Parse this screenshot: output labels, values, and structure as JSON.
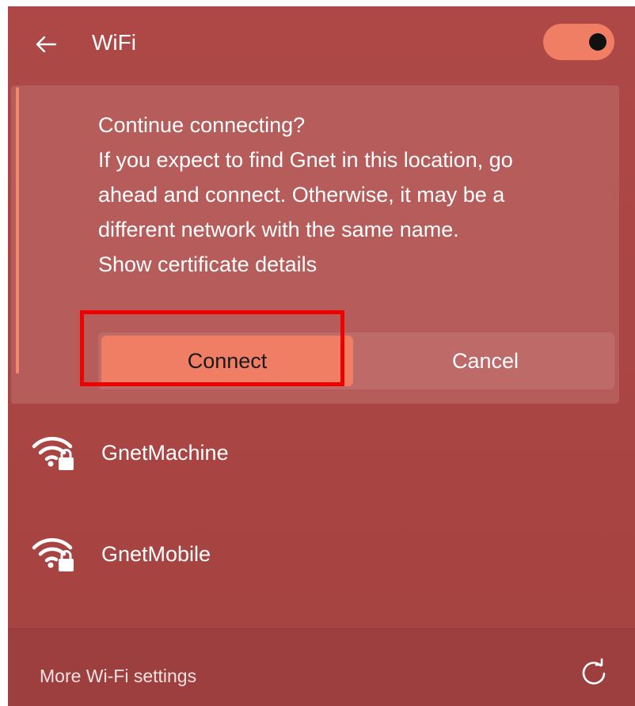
{
  "header": {
    "back_icon": "arrow-left-icon",
    "title": "WiFi",
    "toggle_state": "on"
  },
  "prompt": {
    "heading": "Continue connecting?",
    "message_lines": [
      "If you expect to find Gnet in this location, go",
      "ahead and connect. Otherwise, it may be a",
      "different network with the same name."
    ],
    "cert_link": "Show certificate details",
    "connect_label": "Connect",
    "cancel_label": "Cancel"
  },
  "networks": [
    {
      "name": "GnetMachine",
      "icon": "wifi-secured-icon"
    },
    {
      "name": "GnetMobile",
      "icon": "wifi-secured-icon"
    }
  ],
  "footer": {
    "more_settings": "More Wi-Fi settings",
    "refresh_icon": "refresh-icon"
  },
  "colors": {
    "panel_bg": "#ad4846",
    "accent": "#f07e65",
    "highlight": "#ee0000"
  }
}
